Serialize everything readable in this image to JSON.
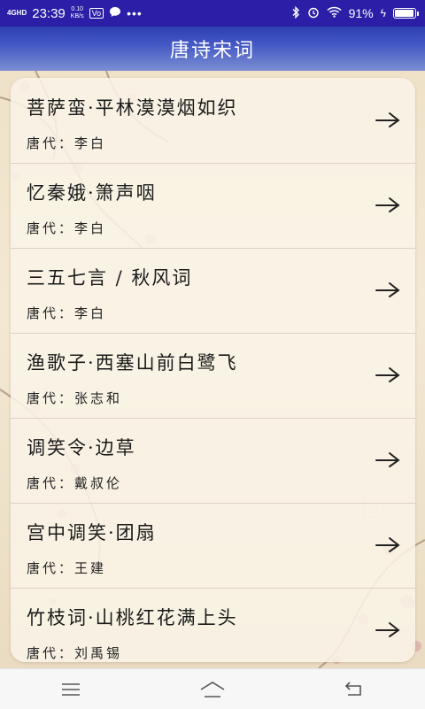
{
  "status_bar": {
    "network": "4GHD",
    "time": "23:39",
    "speed_value": "0.10",
    "speed_unit": "KB/s",
    "app_chip": "Vo",
    "battery_text": "91%"
  },
  "header": {
    "title": "唐诗宋词"
  },
  "poems": [
    {
      "title": "菩萨蛮·平林漠漠烟如织",
      "dynasty": "唐代：李白"
    },
    {
      "title": "忆秦娥·箫声咽",
      "dynasty": "唐代：李白"
    },
    {
      "title": "三五七言 / 秋风词",
      "dynasty": "唐代：李白"
    },
    {
      "title": "渔歌子·西塞山前白鹭飞",
      "dynasty": "唐代：张志和"
    },
    {
      "title": "调笑令·边草",
      "dynasty": "唐代：戴叔伦"
    },
    {
      "title": "宫中调笑·团扇",
      "dynasty": "唐代：王建"
    },
    {
      "title": "竹枝词·山桃红花满上头",
      "dynasty": "唐代：刘禹锡"
    }
  ],
  "colors": {
    "status_bar": "#2b1fa8",
    "title_bar": "#4257c4",
    "background": "#f4ead9"
  },
  "icons": {
    "row_action": "arrow-right-icon",
    "nav": [
      "menu-icon",
      "home-icon",
      "back-icon"
    ]
  }
}
